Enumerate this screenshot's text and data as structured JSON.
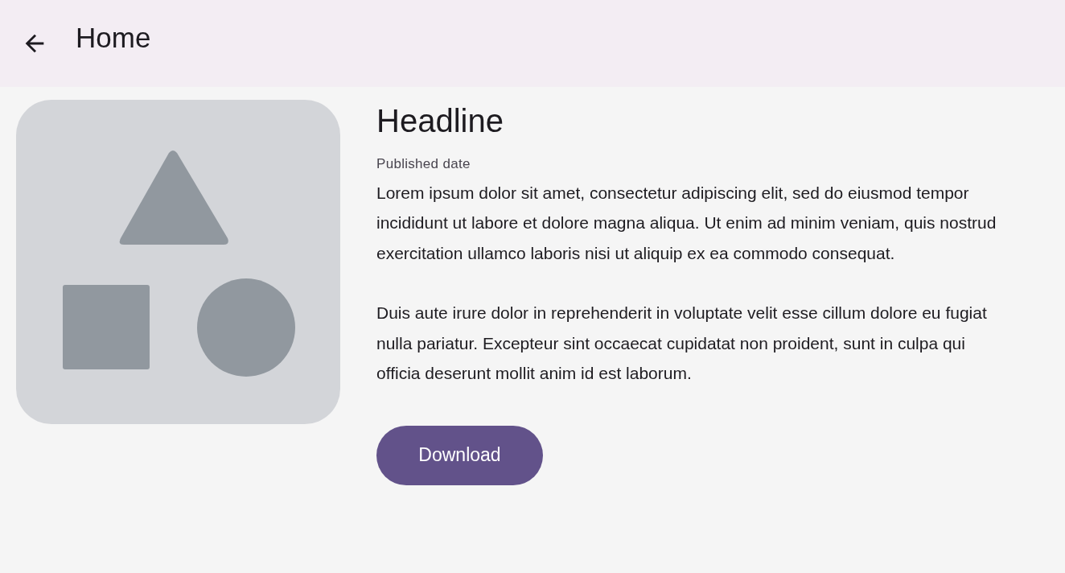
{
  "top_bar": {
    "title": "Home"
  },
  "article": {
    "headline": "Headline",
    "published": "Published date",
    "paragraphs": [
      "Lorem ipsum dolor sit amet, consectetur adipiscing elit, sed do eiusmod tempor incididunt ut labore et dolore magna aliqua. Ut enim ad minim veniam, quis nostrud exercitation ullamco laboris nisi ut aliquip ex ea commodo consequat.",
      "Duis aute irure dolor in reprehenderit in voluptate velit esse cillum dolore eu fugiat nulla pariatur. Excepteur sint occaecat cupidatat non proident, sunt in culpa qui officia deserunt mollit anim id est laborum."
    ],
    "button": "Download"
  }
}
